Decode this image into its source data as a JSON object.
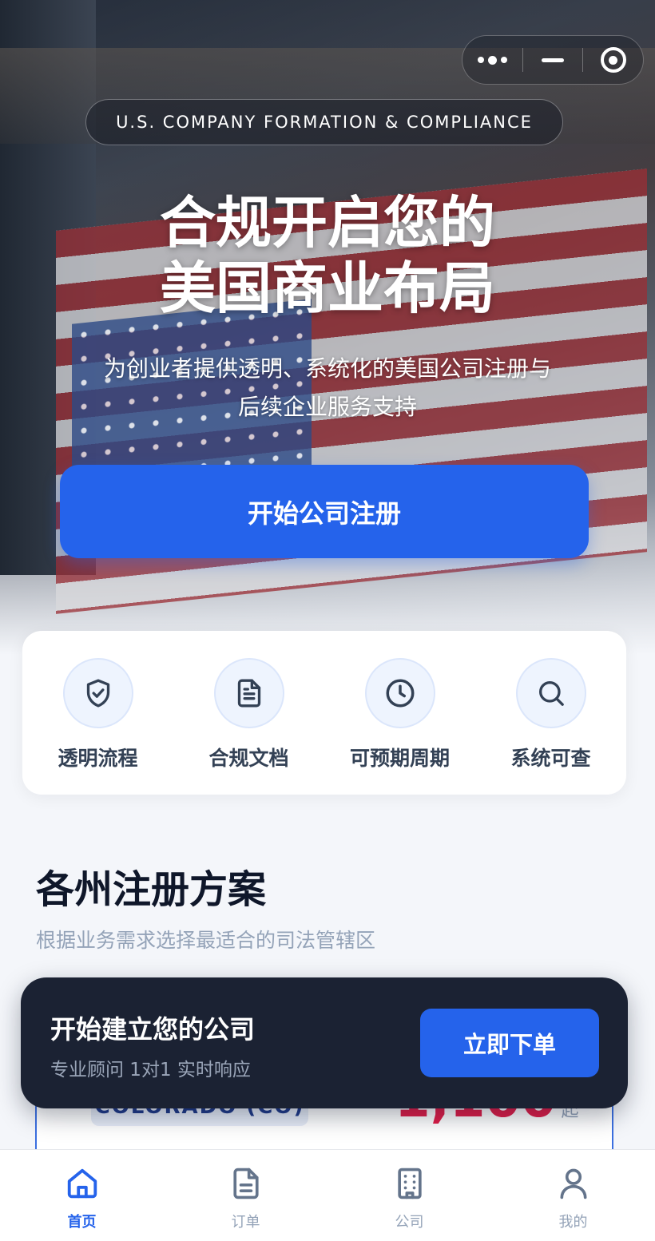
{
  "capsule": {
    "more_icon": "more-dots-icon",
    "minimize_icon": "minimize-icon",
    "close_icon": "target-close-icon"
  },
  "hero": {
    "tagline": "U.S. COMPANY FORMATION & COMPLIANCE",
    "title_line1": "合规开启您的",
    "title_line2": "美国商业布局",
    "subtitle_line1": "为创业者提供透明、系统化的美国公司注册与",
    "subtitle_line2": "后续企业服务支持",
    "cta_label": "开始公司注册"
  },
  "features": [
    {
      "label": "透明流程",
      "icon": "shield-check-icon"
    },
    {
      "label": "合规文档",
      "icon": "document-icon"
    },
    {
      "label": "可预期周期",
      "icon": "clock-icon"
    },
    {
      "label": "系统可查",
      "icon": "search-icon"
    }
  ],
  "section": {
    "title": "各州注册方案",
    "subtitle": "根据业务需求选择最适合的司法管辖区"
  },
  "plan": {
    "state": "COLORADO (CO)",
    "currency": "¥",
    "price": "1,100",
    "suffix": "起"
  },
  "banner": {
    "title": "开始建立您的公司",
    "subtitle": "专业顾问 1对1 实时响应",
    "button": "立即下单"
  },
  "tabbar": {
    "items": [
      {
        "label": "首页",
        "icon": "home-icon",
        "active": true
      },
      {
        "label": "订单",
        "icon": "order-icon",
        "active": false
      },
      {
        "label": "公司",
        "icon": "building-icon",
        "active": false
      },
      {
        "label": "我的",
        "icon": "user-icon",
        "active": false
      }
    ]
  },
  "colors": {
    "accent": "#2563eb",
    "banner_bg": "#1b2233",
    "price": "#e11d48",
    "muted": "#94a3b8"
  }
}
